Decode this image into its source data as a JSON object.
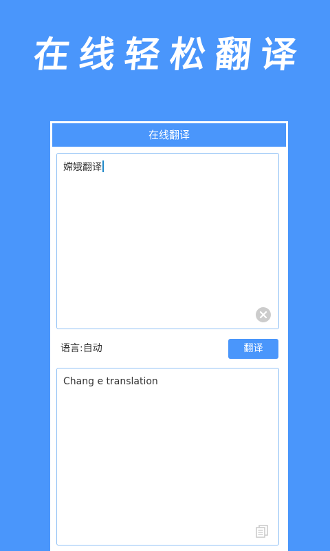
{
  "banner": {
    "title": "在线轻松翻译"
  },
  "app": {
    "title": "在线翻译",
    "source": {
      "text": "嫦娥翻译",
      "clear_icon": "clear-icon"
    },
    "language": {
      "label": "语言:自动"
    },
    "translate_button": {
      "label": "翻译"
    },
    "result": {
      "text": "Chang e translation",
      "copy_icon": "copy-icon"
    }
  },
  "colors": {
    "primary": "#4a96fb",
    "border": "#8fc0f5",
    "text": "#333333",
    "caret": "#1e88c8",
    "icon_gray": "#cccccc"
  }
}
